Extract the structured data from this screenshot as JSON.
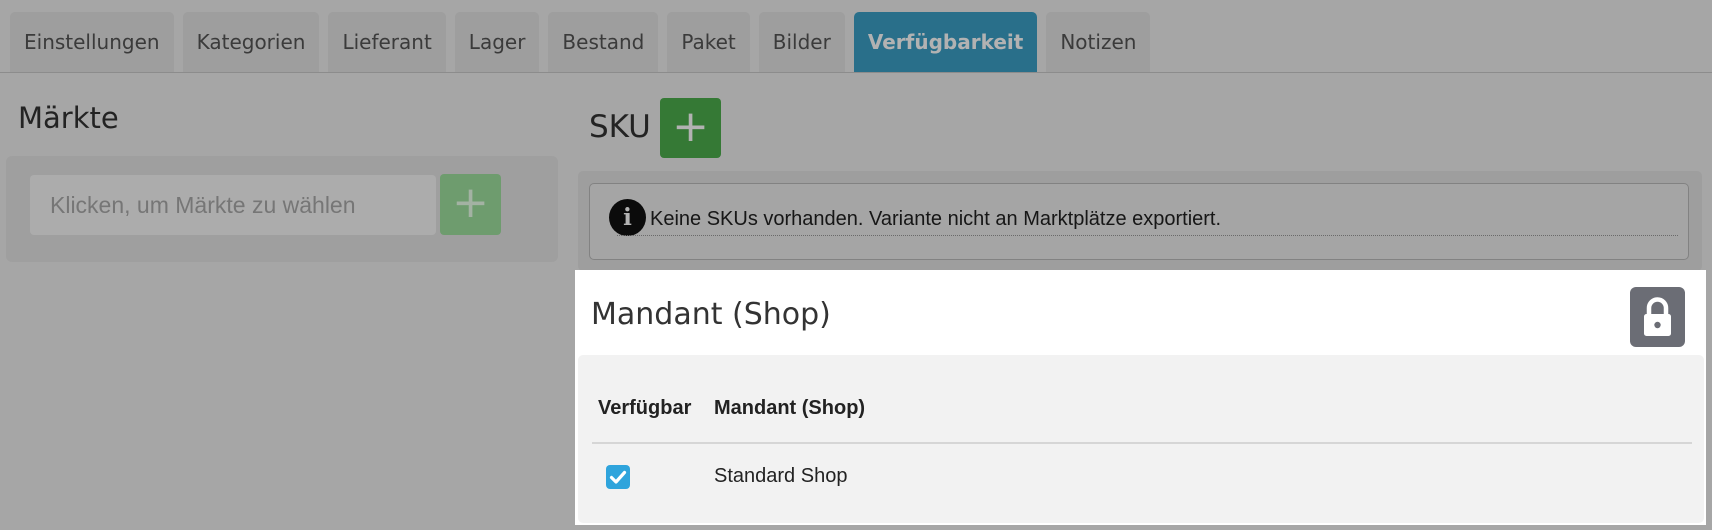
{
  "tabs": [
    {
      "label": "Einstellungen",
      "active": false
    },
    {
      "label": "Kategorien",
      "active": false
    },
    {
      "label": "Lieferant",
      "active": false
    },
    {
      "label": "Lager",
      "active": false
    },
    {
      "label": "Bestand",
      "active": false
    },
    {
      "label": "Paket",
      "active": false
    },
    {
      "label": "Bilder",
      "active": false
    },
    {
      "label": "Verfügbarkeit",
      "active": true
    },
    {
      "label": "Notizen",
      "active": false
    }
  ],
  "maerkte": {
    "title": "Märkte",
    "placeholder": "Klicken, um Märkte zu wählen",
    "add_symbol": "+"
  },
  "sku": {
    "title": "SKU",
    "add_symbol": "+",
    "info_symbol": "i",
    "message": "Keine SKUs vorhanden. Variante nicht an Marktplätze exportiert."
  },
  "mandant": {
    "title": "Mandant (Shop)",
    "lock_icon": "lock-icon",
    "columns": [
      "Verfügbar",
      "Mandant (Shop)"
    ],
    "rows": [
      {
        "available": true,
        "name": "Standard Shop"
      }
    ]
  },
  "colors": {
    "active_tab": "#3b9fc6",
    "add_button": "#4cae4c",
    "checkbox": "#2fa4dc",
    "lock_button": "#6b6d75"
  }
}
